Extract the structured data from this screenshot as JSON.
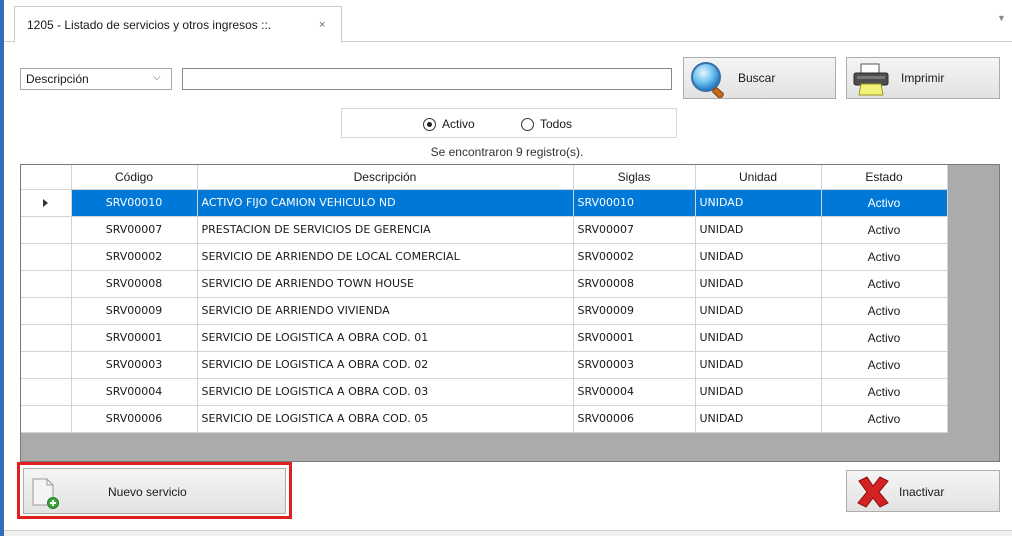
{
  "tab": {
    "title": "1205 - Listado de servicios y otros ingresos ::.",
    "close_glyph": "×"
  },
  "filter": {
    "selected": "Descripción",
    "search_value": ""
  },
  "buttons": {
    "buscar_label": "Buscar",
    "imprimir_label": "Imprimir",
    "nuevo_label": "Nuevo servicio",
    "inactivar_label": "Inactivar"
  },
  "status_filter": {
    "options": [
      {
        "label": "Activo",
        "selected": true
      },
      {
        "label": "Todos",
        "selected": false
      }
    ]
  },
  "records_text": "Se encontraron 9 registro(s).",
  "table": {
    "columns": [
      "Código",
      "Descripción",
      "Siglas",
      "Unidad",
      "Estado"
    ],
    "rows": [
      [
        "SRV00010",
        "ACTIVO FIJO CAMION VEHICULO ND",
        "SRV00010",
        "UNIDAD",
        "Activo"
      ],
      [
        "SRV00007",
        "PRESTACION DE SERVICIOS DE GERENCIA",
        "SRV00007",
        "UNIDAD",
        "Activo"
      ],
      [
        "SRV00002",
        "SERVICIO DE ARRIENDO DE LOCAL COMERCIAL",
        "SRV00002",
        "UNIDAD",
        "Activo"
      ],
      [
        "SRV00008",
        "SERVICIO DE ARRIENDO TOWN HOUSE",
        "SRV00008",
        "UNIDAD",
        "Activo"
      ],
      [
        "SRV00009",
        "SERVICIO DE ARRIENDO VIVIENDA",
        "SRV00009",
        "UNIDAD",
        "Activo"
      ],
      [
        "SRV00001",
        "SERVICIO DE LOGISTICA A OBRA COD. 01",
        "SRV00001",
        "UNIDAD",
        "Activo"
      ],
      [
        "SRV00003",
        "SERVICIO DE LOGISTICA A OBRA COD. 02",
        "SRV00003",
        "UNIDAD",
        "Activo"
      ],
      [
        "SRV00004",
        "SERVICIO DE LOGISTICA A OBRA COD. 03",
        "SRV00004",
        "UNIDAD",
        "Activo"
      ],
      [
        "SRV00006",
        "SERVICIO DE LOGISTICA A OBRA COD. 05",
        "SRV00006",
        "UNIDAD",
        "Activo"
      ]
    ],
    "selected_row": 0
  },
  "colors": {
    "selection": "#0078d7",
    "highlight_border": "#e02020",
    "grid_background": "#ababab"
  },
  "icons": {
    "buscar": "magnifier-icon",
    "imprimir": "printer-icon",
    "nuevo": "new-document-icon",
    "inactivar": "red-x-icon"
  }
}
